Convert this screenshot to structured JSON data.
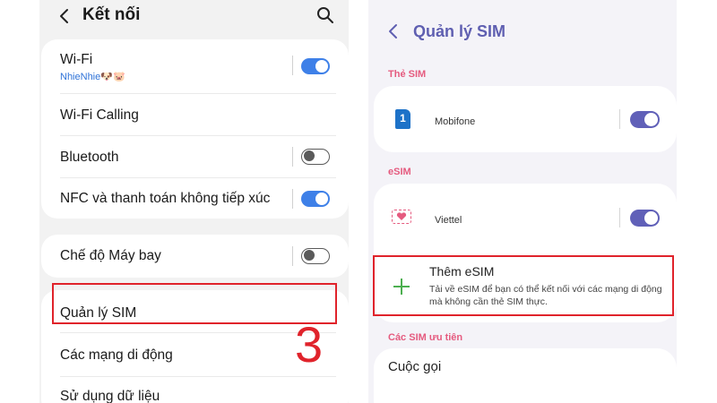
{
  "left": {
    "header": {
      "title": "Kết nối",
      "back_icon": "chevron-left-icon",
      "search_icon": "search-icon"
    },
    "items": {
      "wifi": {
        "label": "Wi-Fi",
        "network": "NhieNhie🐶🐷",
        "toggle": true
      },
      "wifi_calling": {
        "label": "Wi-Fi Calling"
      },
      "bluetooth": {
        "label": "Bluetooth",
        "toggle": false
      },
      "nfc": {
        "label": "NFC và thanh toán không tiếp xúc",
        "toggle": true
      },
      "airplane": {
        "label": "Chế độ Máy bay",
        "toggle": false
      },
      "sim_manager": {
        "label": "Quản lý SIM"
      },
      "mobile_networks": {
        "label": "Các mạng di động"
      },
      "data_usage": {
        "label": "Sử dụng dữ liệu"
      }
    },
    "step_number": "3"
  },
  "right": {
    "header": {
      "title": "Quản lý SIM",
      "back_icon": "chevron-left-icon"
    },
    "sections": {
      "sim_cards": "Thẻ SIM",
      "esim": "eSIM",
      "preferred": "Các SIM ưu tiên"
    },
    "sims": [
      {
        "name": "Mobifone",
        "badge": "1",
        "toggle": true
      },
      {
        "name": "Viettel",
        "toggle": true
      }
    ],
    "add_esim": {
      "title": "Thêm eSIM",
      "description": "Tải về eSIM để bạn có thể kết nối với các mạng di động mà không cần thẻ SIM thực."
    },
    "calls_label": "Cuộc gọi"
  },
  "colors": {
    "left_toggle_on": "#3e80e8",
    "right_toggle_on": "#6060b8",
    "right_title": "#5f5fb1",
    "section_heading": "#e55b7f",
    "highlight_red": "#e0232b",
    "add_plus": "#4caf50"
  }
}
